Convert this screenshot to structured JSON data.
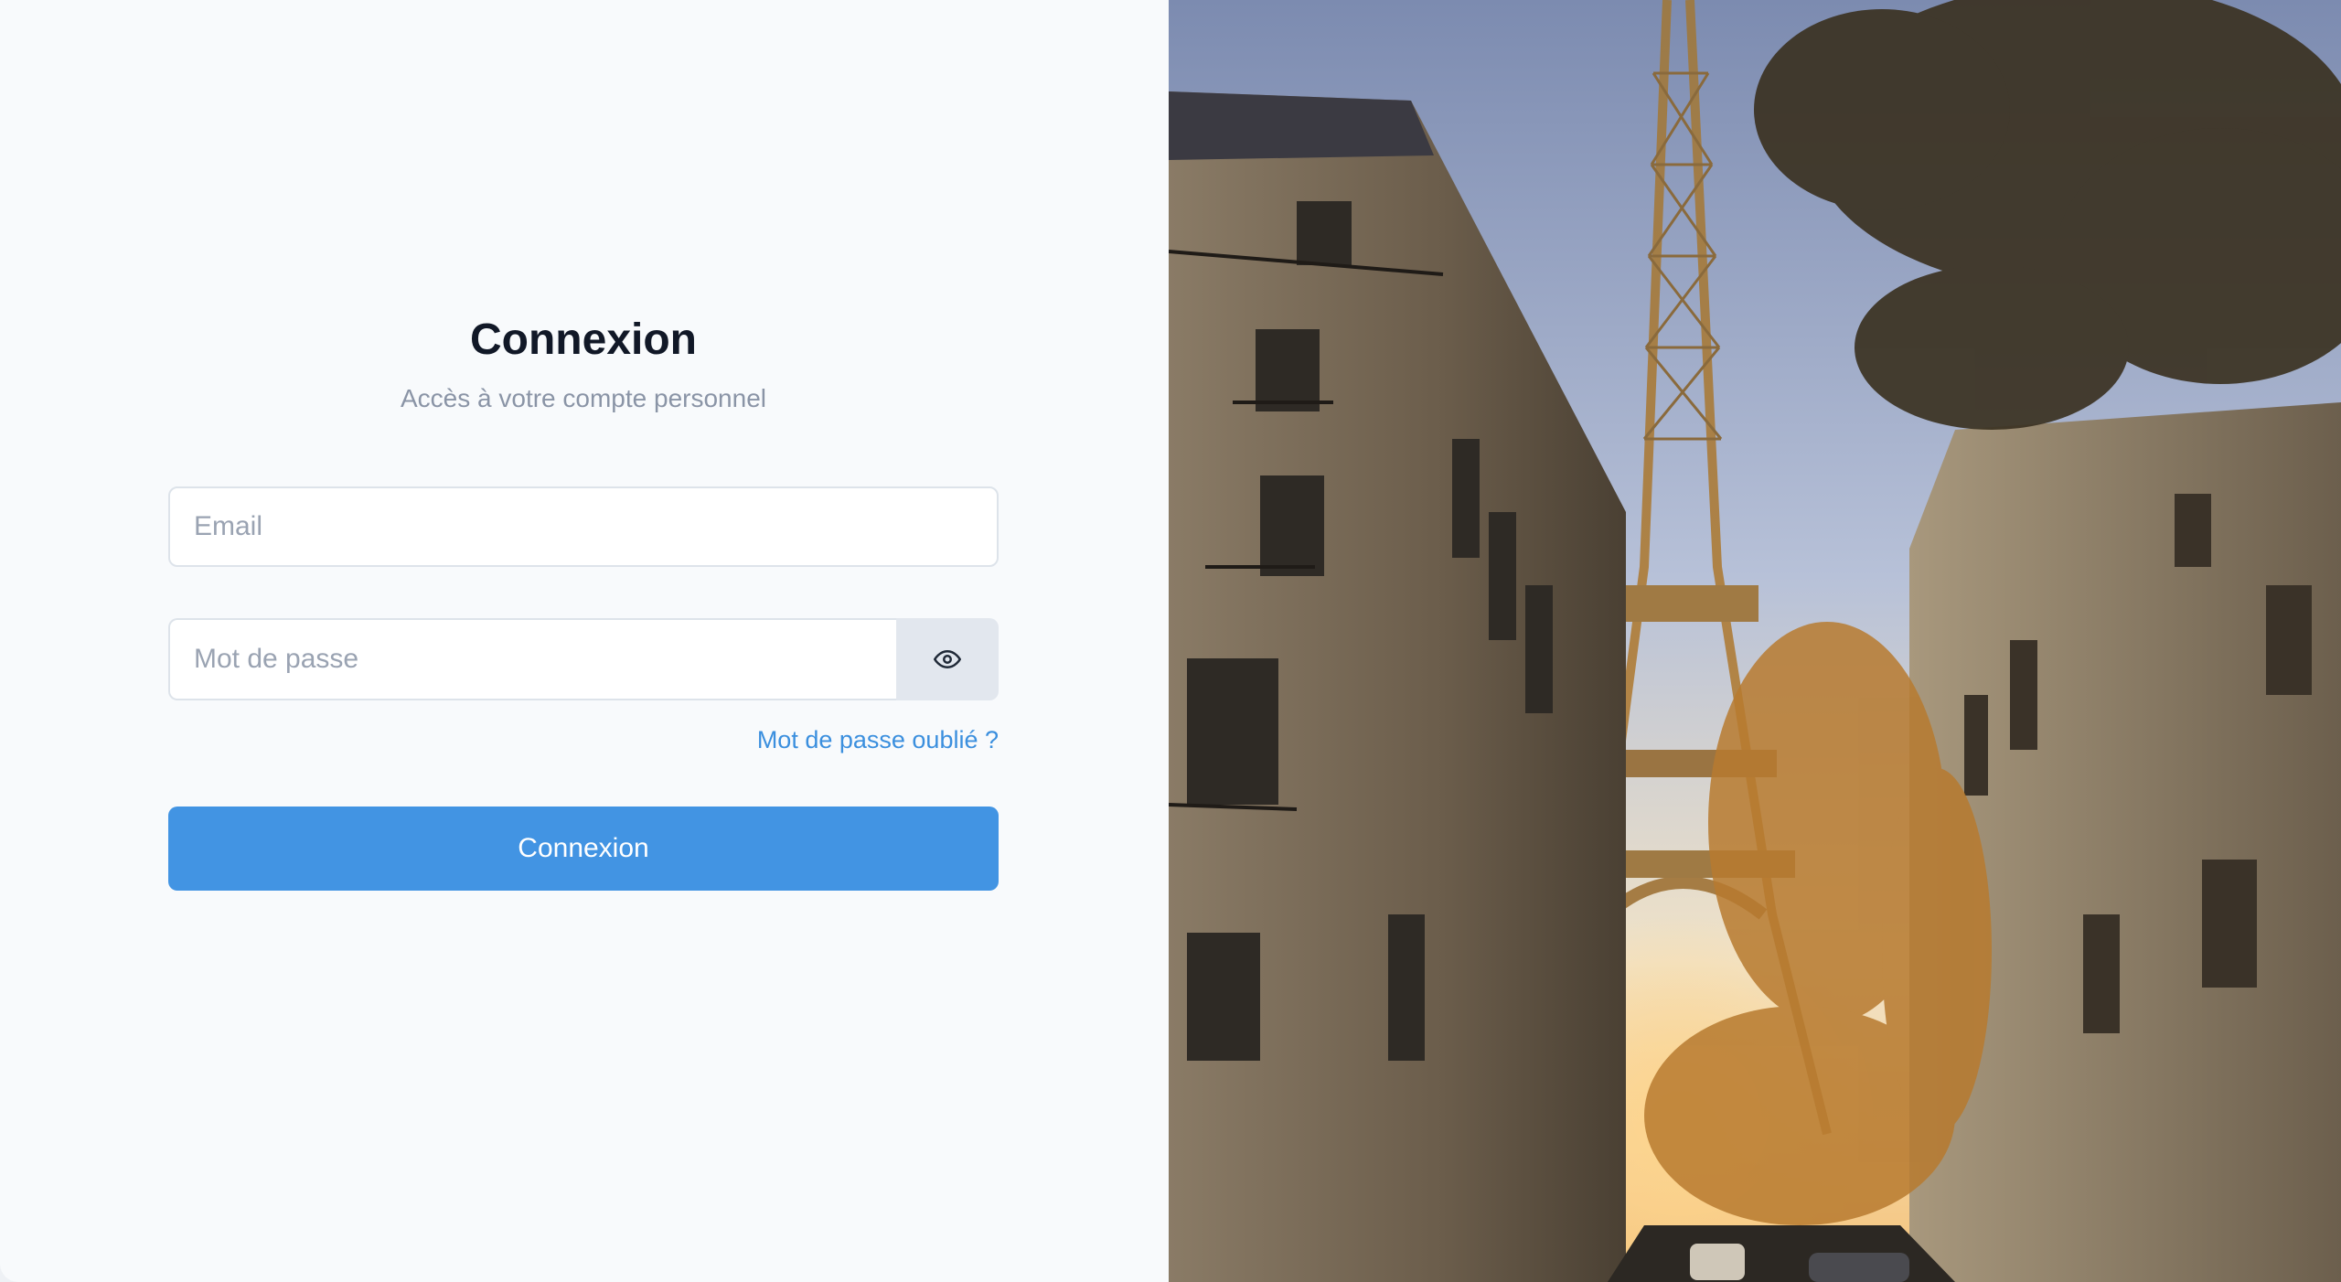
{
  "login": {
    "title": "Connexion",
    "subtitle": "Accès à votre compte personnel",
    "email_placeholder": "Email",
    "password_placeholder": "Mot de passe",
    "forgot_link": "Mot de passe oublié ?",
    "submit_label": "Connexion"
  },
  "icons": {
    "password_toggle": "eye-icon"
  },
  "colors": {
    "accent": "#4294e3",
    "link": "#3b8fde",
    "title": "#111827",
    "subtitle": "#8a94a6",
    "background": "#f8fafc"
  }
}
